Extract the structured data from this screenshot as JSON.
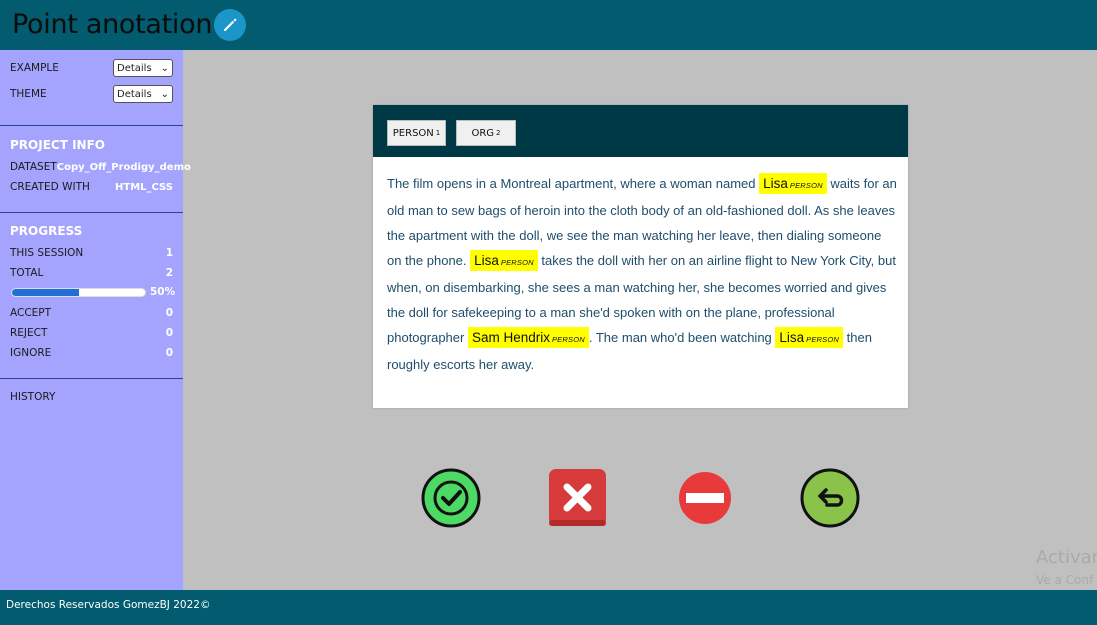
{
  "header": {
    "title": "Point anotation",
    "edit_icon": "pencil-icon"
  },
  "sidebar": {
    "example_label": "EXAMPLE",
    "example_select": "Details",
    "theme_label": "THEME",
    "theme_select": "Details",
    "project_info_title": "PROJECT INFO",
    "dataset_label": "DATASET",
    "dataset_value": "Copy_Off_Prodigy_demo",
    "created_label": "CREATED WITH",
    "created_value": "HTML_CSS",
    "progress_title": "PROGRESS",
    "this_session_label": "THIS SESSION",
    "this_session_value": "1",
    "total_label": "TOTAL",
    "total_value": "2",
    "progress_value": 0.5,
    "progress_pct": "50%",
    "accept_label": "ACCEPT",
    "accept_value": "0",
    "reject_label": "REJECT",
    "reject_value": "0",
    "ignore_label": "IGNORE",
    "ignore_value": "0",
    "history_label": "HISTORY"
  },
  "card": {
    "labels": [
      {
        "name": "PERSON",
        "key": "1"
      },
      {
        "name": "ORG",
        "key": "2"
      }
    ],
    "text_parts": [
      "The film opens in a Montreal apartment, where a woman named ",
      " waits for an old man to sew bags of heroin into the cloth body of an old-fashioned doll. As she leaves the apartment with the doll, we see the man watching her leave, then dialing someone on the phone. ",
      " takes the doll with her on an airline flight to New York City, but when, on disembarking, she sees a man watching her, she becomes worried and gives the doll for safekeeping to a man she'd spoken with on the plane, professional photographer ",
      ". The man who'd been watching ",
      " then roughly escorts her away."
    ],
    "entities": [
      {
        "text": "Lisa",
        "tag": "PERSON"
      },
      {
        "text": "Lisa",
        "tag": "PERSON"
      },
      {
        "text": "Sam Hendrix",
        "tag": "PERSON"
      },
      {
        "text": "Lisa",
        "tag": "PERSON"
      }
    ]
  },
  "actions": {
    "accept_icon": "check-icon",
    "reject_icon": "x-icon",
    "ignore_icon": "no-entry-icon",
    "undo_icon": "undo-icon",
    "colors": {
      "accept": "#4cd964",
      "reject": "#d63a3a",
      "ignore": "#e83a3a",
      "undo": "#8bc34a"
    }
  },
  "footer": {
    "text": "Derechos Reservados GomezBJ 2022©"
  },
  "watermark": {
    "line1": "Activar",
    "line2": "Ve a Conf"
  }
}
